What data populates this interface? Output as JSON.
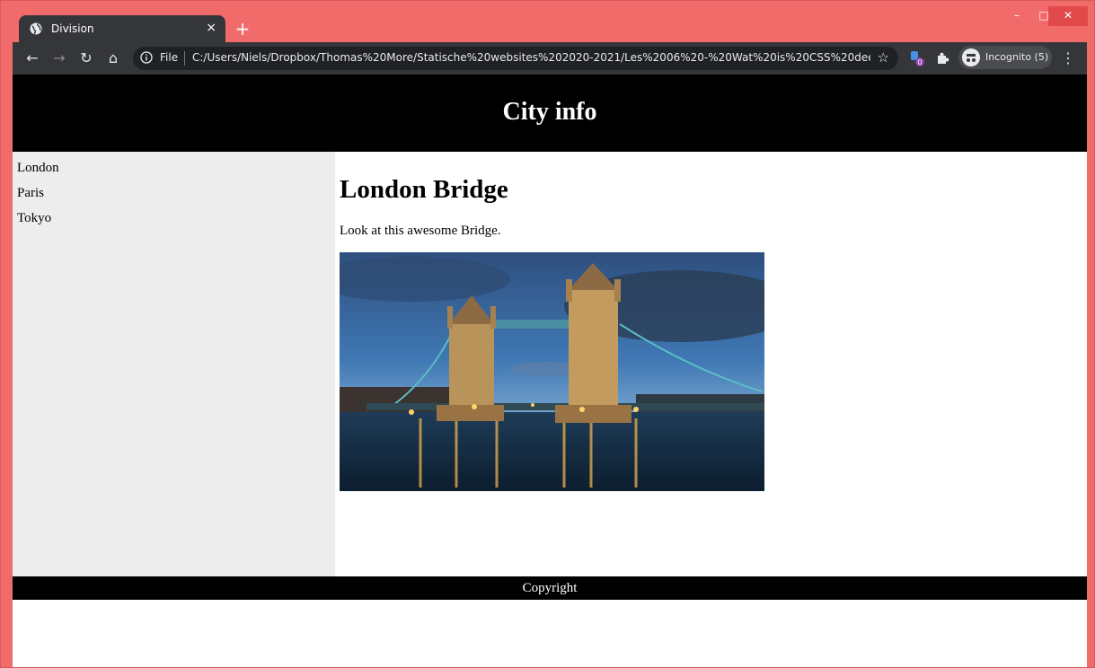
{
  "browser": {
    "tab_title": "Division",
    "tab_close": "×",
    "new_tab": "+",
    "window_controls": {
      "minimize": "–",
      "maximize": "□",
      "close": "✕"
    },
    "url_scheme_label": "File",
    "url": "C:/Users/Niels/Dropbox/Thomas%20More/Statische%20websites%202020-2021/Les%2006%20-%20Wat%20is%20CSS%20dee...",
    "extension_badge": "0",
    "incognito_label": "Incognito (5)",
    "icons": [
      "globe-icon",
      "back-icon",
      "forward-icon",
      "reload-icon",
      "home-icon",
      "info-icon",
      "star-icon",
      "extension-icon",
      "puzzle-icon",
      "incognito-icon",
      "kebab-menu-icon"
    ]
  },
  "page": {
    "header_title": "City info",
    "sidebar": {
      "items": [
        {
          "label": "London"
        },
        {
          "label": "Paris"
        },
        {
          "label": "Tokyo"
        }
      ]
    },
    "main": {
      "heading": "London Bridge",
      "text": "Look at this awesome Bridge.",
      "image_subject": "Tower Bridge at dusk"
    },
    "footer": "Copyright"
  },
  "colors": {
    "window_frame": "#f26b6b",
    "toolbar": "#35363a",
    "header_bg": "#000000",
    "sidebar_bg": "#ededed",
    "footer_bg": "#000000"
  }
}
